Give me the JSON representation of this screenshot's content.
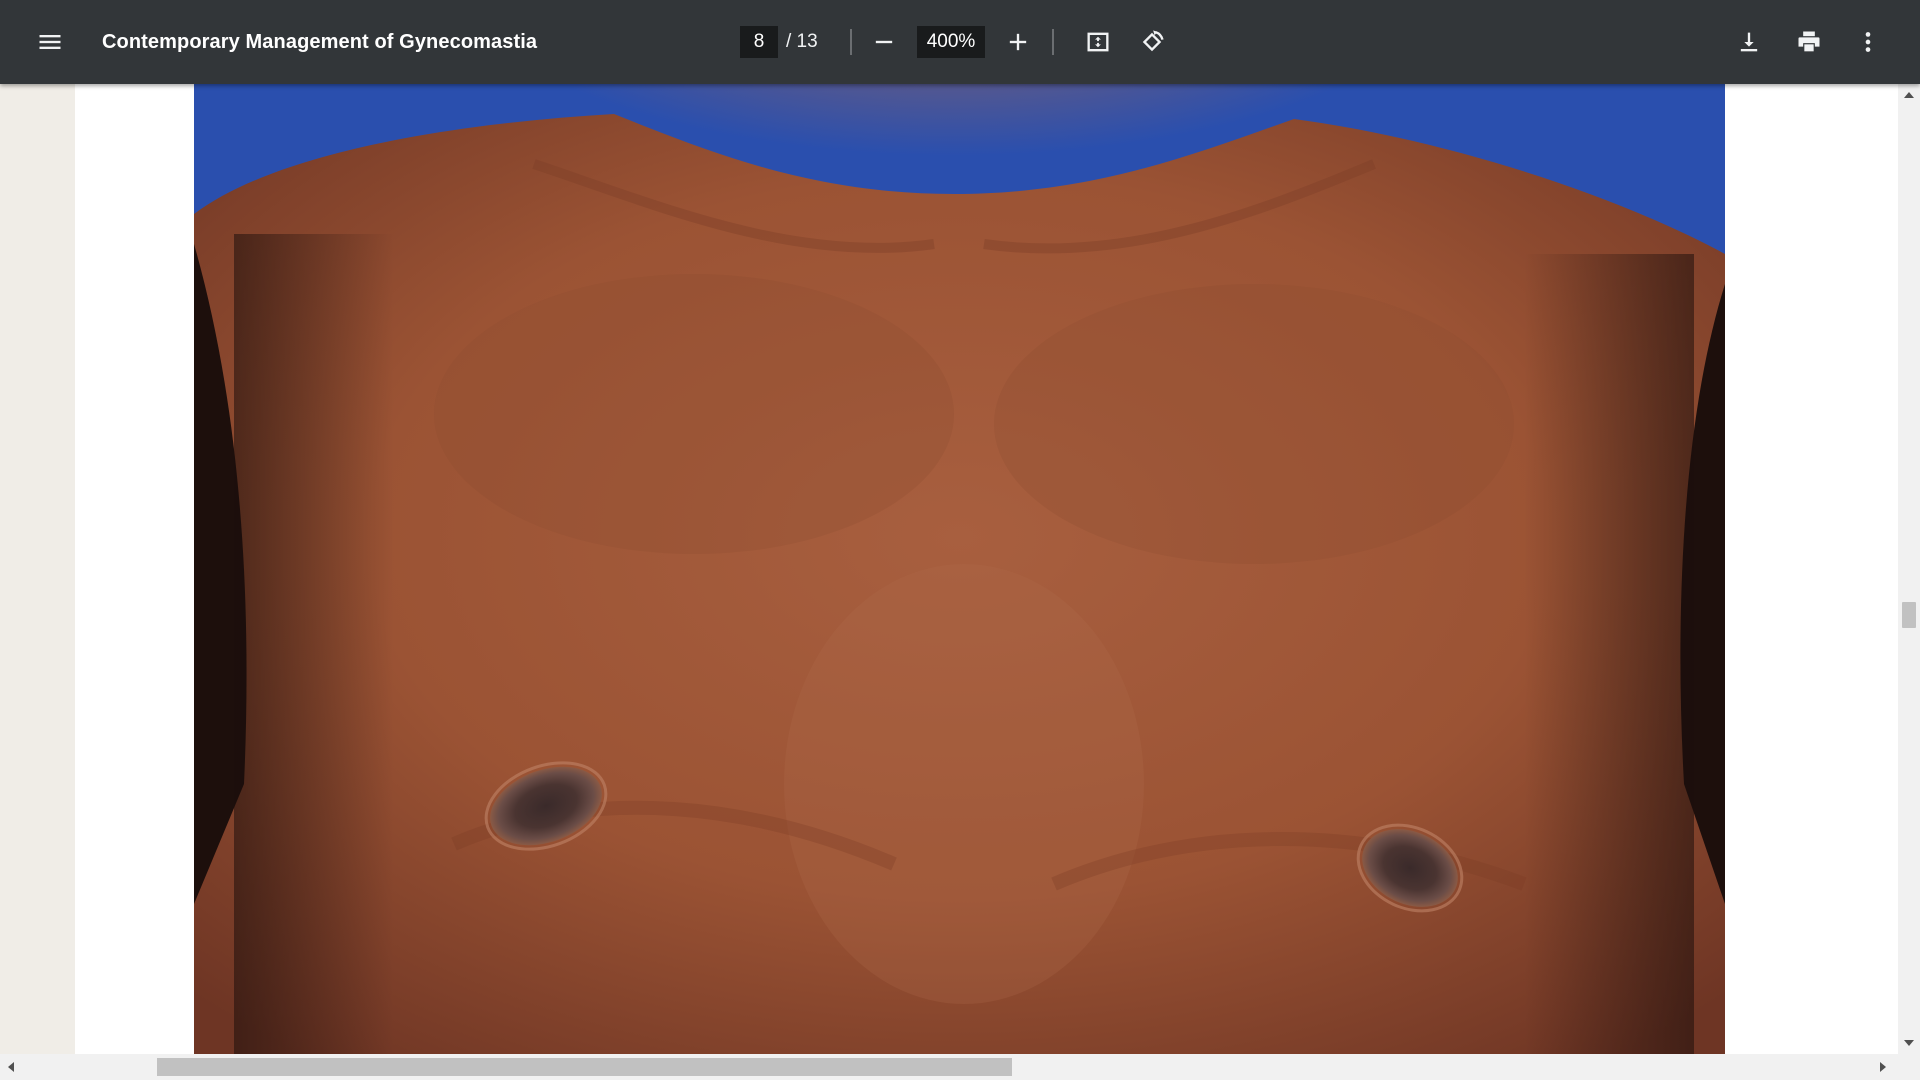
{
  "toolbar": {
    "title": "Contemporary Management of Gynecomastia",
    "current_page": "8",
    "page_total": "/ 13",
    "zoom": "400%",
    "icons": {
      "menu": "hamburger-menu-icon",
      "zoom_out": "minus-icon",
      "zoom_in": "plus-icon",
      "fit": "fit-to-page-icon",
      "rotate": "rotate-counterclockwise-icon",
      "download": "download-icon",
      "print": "print-icon",
      "more": "more-vertical-icon"
    }
  },
  "colors": {
    "toolbar_bg": "#323639",
    "photo_backdrop": "#2a4fae",
    "skin": "#a0583a"
  }
}
